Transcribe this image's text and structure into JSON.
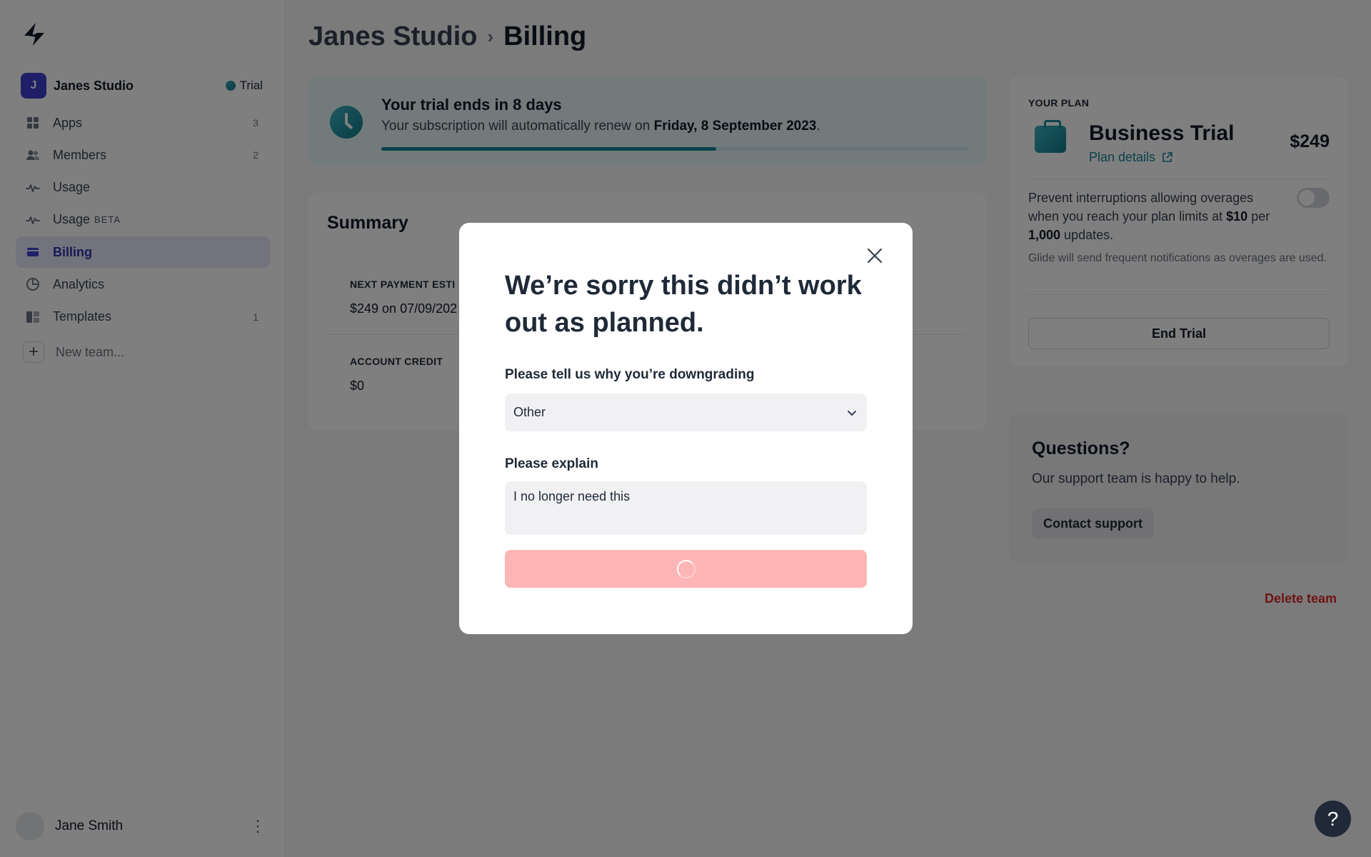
{
  "sidebar": {
    "team": {
      "initial": "J",
      "name": "Janes Studio",
      "badge": "Trial"
    },
    "items": [
      {
        "label": "Apps",
        "count": "3",
        "icon": "grid-icon"
      },
      {
        "label": "Members",
        "count": "2",
        "icon": "people-icon"
      },
      {
        "label": "Usage",
        "count": "",
        "icon": "activity-icon"
      },
      {
        "label": "Usage",
        "beta": "BETA",
        "count": "",
        "icon": "activity-icon"
      },
      {
        "label": "Billing",
        "count": "",
        "icon": "card-icon",
        "active": true
      },
      {
        "label": "Analytics",
        "count": "",
        "icon": "pie-chart-icon"
      },
      {
        "label": "Templates",
        "count": "1",
        "icon": "templates-icon"
      }
    ],
    "new_team": "New team...",
    "user": {
      "name": "Jane Smith"
    }
  },
  "breadcrumb": {
    "team": "Janes Studio",
    "page": "Billing"
  },
  "trial": {
    "title": "Your trial ends in 8 days",
    "sub_prefix": "Your subscription will automatically renew on ",
    "renew_date": "Friday, 8 September 2023",
    "sub_suffix": ".",
    "progress": 0.57
  },
  "summary": {
    "title": "Summary",
    "next_payment_label": "NEXT PAYMENT ESTI",
    "next_payment_value": "$249 on 07/09/202",
    "credit_label": "ACCOUNT CREDIT",
    "credit_value": "$0"
  },
  "plan": {
    "kicker": "YOUR PLAN",
    "name": "Business Trial",
    "link": "Plan details",
    "price": "$249",
    "overage_1": "Prevent interruptions allowing overages when you reach your plan limits at ",
    "overage_price": "$10",
    "overage_2": " per ",
    "overage_units": "1,000",
    "overage_3": " updates.",
    "overage_note": "Glide will send frequent notifications as overages are used.",
    "end_trial": "End Trial"
  },
  "help": {
    "title": "Questions?",
    "sub": "Our support team is happy to help.",
    "button": "Contact support"
  },
  "delete_team": "Delete team",
  "fab": "?",
  "modal": {
    "title": "We’re sorry this didn’t work out as planned.",
    "reason_label": "Please tell us why you’re downgrading",
    "reason_value": "Other",
    "explain_label": "Please explain",
    "explain_value": "I no longer need this"
  },
  "colors": {
    "accent": "#3c3fcf",
    "teal": "#128395",
    "danger": "#dc2626",
    "submit_disabled": "#feb5b5"
  }
}
